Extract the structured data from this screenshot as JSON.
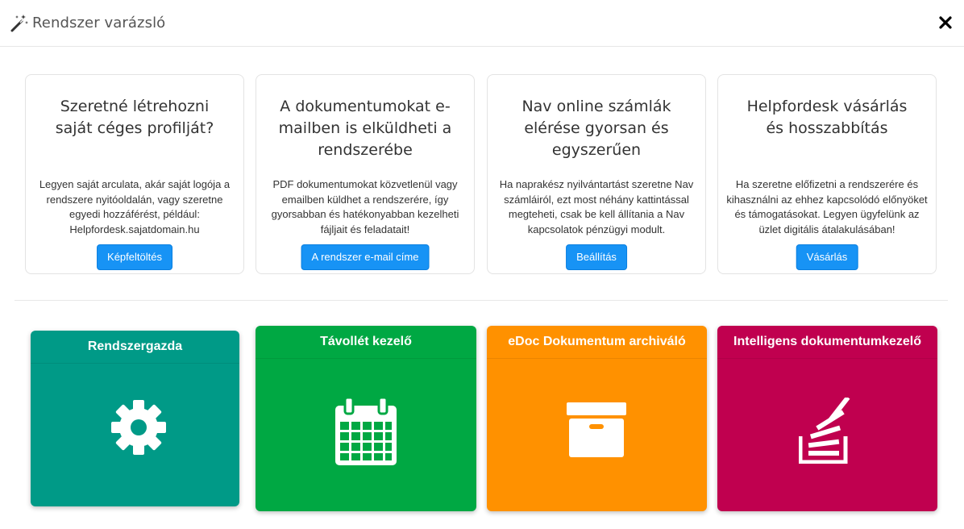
{
  "header": {
    "title": "Rendszer varázsló",
    "wand_icon": "magic-wand-icon",
    "close_icon": "close-icon"
  },
  "cards": [
    {
      "heading": "Szeretné létrehozni saját céges profilját?",
      "body": "Legyen saját arculata, akár saját logója a rendszere nyitóoldalán, vagy szeretne egyedi hozzáférést, például: Helpfordesk.sajatdomain.hu",
      "button": "Képfeltöltés"
    },
    {
      "heading": "A dokumentumokat e-mailben is elküldheti a rendszerébe",
      "body": "PDF dokumentumokat közvetlenül vagy emailben küldhet a rendszerére, így gyorsabban és hatékonyabban kezelheti fájljait és feladatait!",
      "button": "A rendszer e-mail címe"
    },
    {
      "heading": "Nav online számlák elérése gyorsan és egyszerűen",
      "body": "Ha naprakész nyilvántartást szeretne Nav számláiról, ezt most néhány kattintással megteheti, csak be kell állítania a Nav kapcsolatok pénzügyi modult.",
      "button": "Beállítás"
    },
    {
      "heading": "Helpfordesk vásárlás és hosszabbítás",
      "body": "Ha szeretne előfizetni a rendszerére és kihasználni az ehhez kapcsolódó előnyöket és támogatásokat. Legyen ügyfelünk az üzlet digitális átalakulásában!",
      "button": "Vásárlás"
    }
  ],
  "tiles": [
    {
      "title": "Rendszergazda",
      "color": "#009a87",
      "icon": "gear-icon"
    },
    {
      "title": "Távollét kezelő",
      "color": "#00a843",
      "icon": "calendar-icon"
    },
    {
      "title": "eDoc Dokumentum archiváló",
      "color": "#ff9100",
      "icon": "archive-box-icon"
    },
    {
      "title": "Intelligens dokumentumkezelő",
      "color": "#c0004f",
      "icon": "stack-overflow-icon"
    }
  ]
}
